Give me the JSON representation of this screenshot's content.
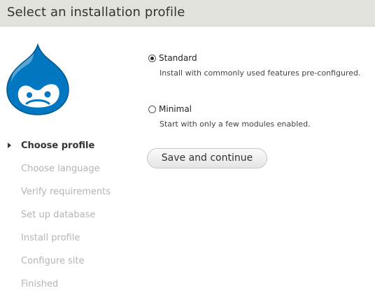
{
  "page": {
    "title": "Select an installation profile"
  },
  "logo": {
    "icon": "drupal-drop-logo",
    "color": "#0077c0"
  },
  "steps": [
    {
      "label": "Choose profile",
      "state": "active"
    },
    {
      "label": "Choose language",
      "state": "pending"
    },
    {
      "label": "Verify requirements",
      "state": "pending"
    },
    {
      "label": "Set up database",
      "state": "pending"
    },
    {
      "label": "Install profile",
      "state": "pending"
    },
    {
      "label": "Configure site",
      "state": "pending"
    },
    {
      "label": "Finished",
      "state": "pending"
    }
  ],
  "profiles": [
    {
      "label": "Standard",
      "description": "Install with commonly used features pre-configured.",
      "selected": true
    },
    {
      "label": "Minimal",
      "description": "Start with only a few modules enabled.",
      "selected": false
    }
  ],
  "actions": {
    "submit_label": "Save and continue"
  },
  "colors": {
    "header_bg": "#e1e2dc",
    "inactive_step": "#b4b4b4",
    "active_step": "#333333"
  }
}
